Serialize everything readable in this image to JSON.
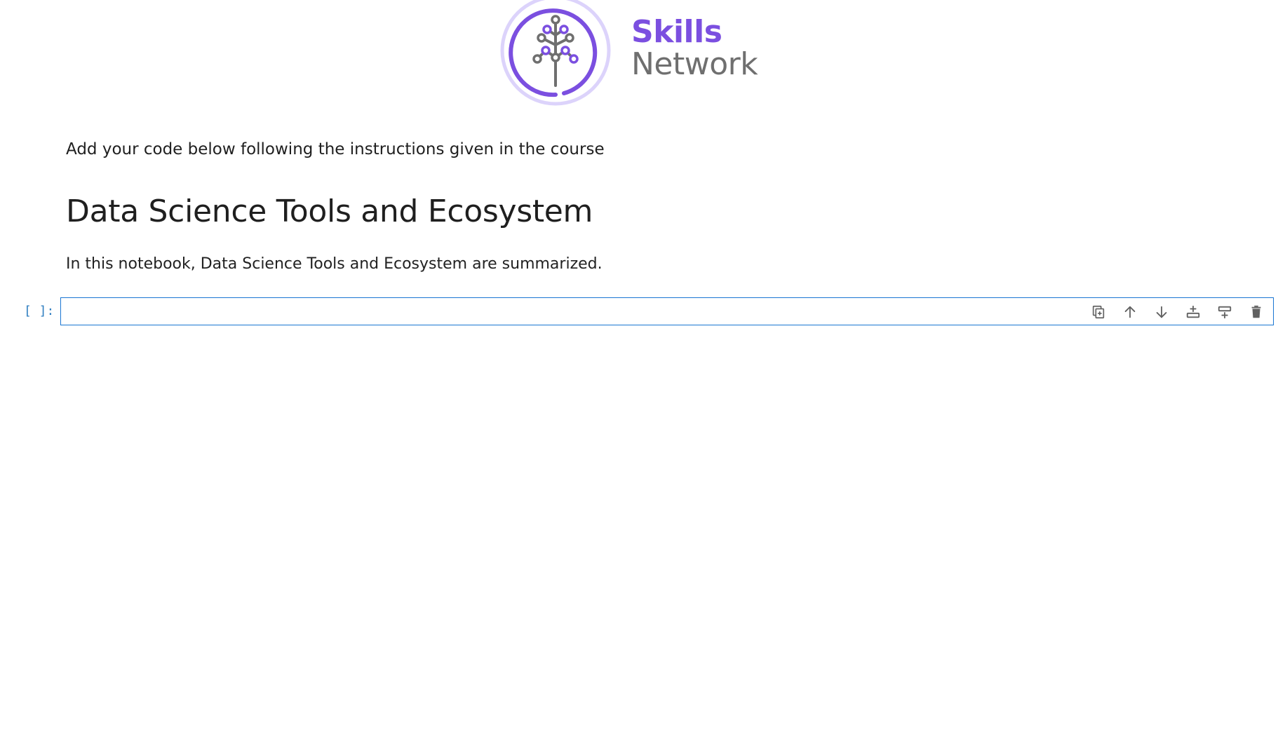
{
  "logo": {
    "line1": "Skills",
    "line2": "Network",
    "brand_color": "#7b4fe0",
    "secondary_color": "#6f6f6f"
  },
  "markdown": {
    "instructions": "Add your code below following the instructions given in the course",
    "heading": "Data Science Tools and Ecosystem",
    "summary": "In this notebook, Data Science Tools and Ecosystem are summarized."
  },
  "code_cell": {
    "prompt": "[ ]:",
    "content": "",
    "border_color": "#1976d2",
    "toolbar": [
      {
        "name": "duplicate-icon",
        "title": "Duplicate"
      },
      {
        "name": "arrow-up-icon",
        "title": "Move up"
      },
      {
        "name": "arrow-down-icon",
        "title": "Move down"
      },
      {
        "name": "insert-below-icon",
        "title": "Insert below"
      },
      {
        "name": "insert-above-icon",
        "title": "Insert above"
      },
      {
        "name": "trash-icon",
        "title": "Delete"
      }
    ]
  }
}
